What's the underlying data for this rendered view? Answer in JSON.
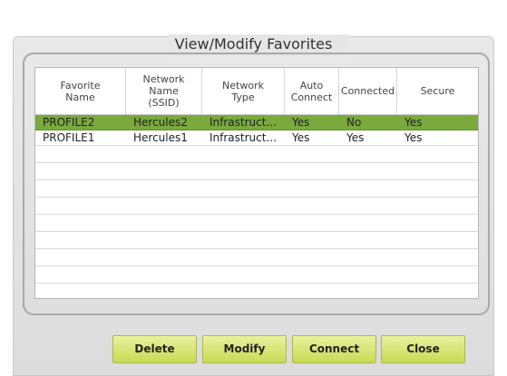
{
  "dialog": {
    "title": "View/Modify Favorites"
  },
  "table": {
    "columns": [
      {
        "label": "Favorite\nName"
      },
      {
        "label": "Network\nName\n(SSID)"
      },
      {
        "label": "Network\nType"
      },
      {
        "label": "Auto\nConnect"
      },
      {
        "label": "Connected"
      },
      {
        "label": "Secure"
      }
    ],
    "rows": [
      {
        "name": "PROFILE2",
        "ssid": "Hercules2",
        "type": "Infrastruct...",
        "auto": "Yes",
        "connected": "No",
        "secure": "Yes",
        "selected": true
      },
      {
        "name": "PROFILE1",
        "ssid": "Hercules1",
        "type": "Infrastruct...",
        "auto": "Yes",
        "connected": "Yes",
        "secure": "Yes",
        "selected": false
      }
    ]
  },
  "buttons": {
    "delete": "Delete",
    "modify": "Modify",
    "connect": "Connect",
    "close": "Close"
  },
  "colors": {
    "selected_row": "#7aaa3c",
    "button_top": "#e8f29c",
    "button_bottom": "#c8da55"
  }
}
